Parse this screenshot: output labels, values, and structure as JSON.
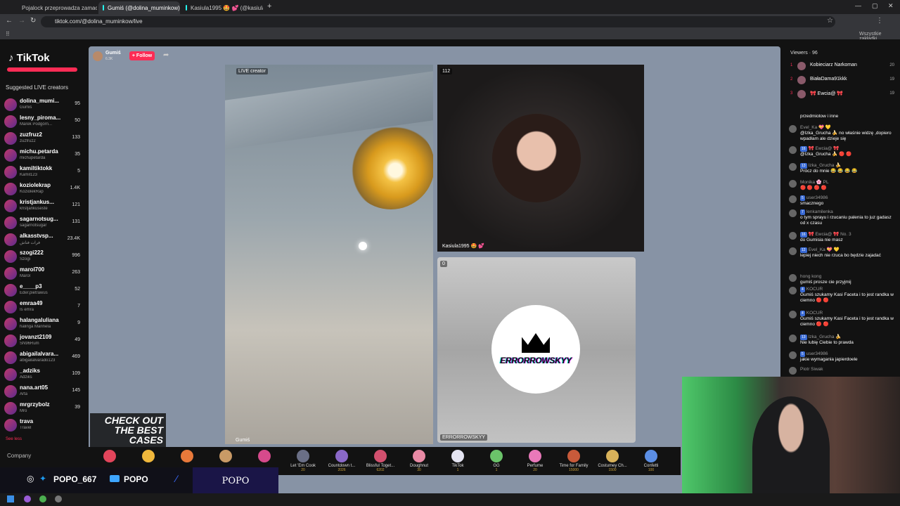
{
  "browser": {
    "tabs": [
      {
        "title": "Pojalock przeprowadza zamach"
      },
      {
        "title": "Gumiś (@dolina_muminkow)"
      },
      {
        "title": "Kasiula1995 🤩 💕 (@kasiula"
      }
    ],
    "url": "tiktok.com/@dolina_muminkow/live",
    "bookmarks_label": "Wszystkie zakładki"
  },
  "sidebar": {
    "logo": "TikTok",
    "suggested_title": "Suggested LIVE creators",
    "creators": [
      {
        "name": "dolina_mumi...",
        "sub": "Gumiś",
        "count": "95"
      },
      {
        "name": "lesny_piroma...",
        "sub": "Marek Podgórn...",
        "count": "50"
      },
      {
        "name": "zuzfruz2",
        "sub": "zuzfruz2",
        "count": "133"
      },
      {
        "name": "michu.petarda",
        "sub": "michupetarda",
        "count": "35"
      },
      {
        "name": "kamiltiktokk",
        "sub": "Kamil123",
        "count": "5"
      },
      {
        "name": "koziolekrap",
        "sub": "KoziolekRap",
        "count": "1.4K"
      },
      {
        "name": "kristjankus...",
        "sub": "kristjankuseste",
        "count": "121"
      },
      {
        "name": "sagarnotsug...",
        "sub": "sagarnotsugar",
        "count": "131"
      },
      {
        "name": "alkasstvsp...",
        "sub": "فرات فناش",
        "count": "23.4K"
      },
      {
        "name": "szogi222",
        "sub": "Szogi",
        "count": "996"
      },
      {
        "name": "marol700",
        "sub": "Marol",
        "count": "263"
      },
      {
        "name": "e____p3",
        "sub": "Eder.pietrawus",
        "count": "52"
      },
      {
        "name": "emraa49",
        "sub": "Is emra",
        "count": "7"
      },
      {
        "name": "halangaluliana",
        "sub": "halinga Marinela",
        "count": "9"
      },
      {
        "name": "jovanzt2109",
        "sub": "SN96Rum",
        "count": "49"
      },
      {
        "name": "abigailalvara...",
        "sub": "abigailalvarado123",
        "count": "469"
      },
      {
        "name": "_adziks",
        "sub": "Adziks",
        "count": "109"
      },
      {
        "name": "nana.art05",
        "sub": "Arta",
        "count": "145"
      },
      {
        "name": "mrgrzybolz",
        "sub": "Mro",
        "count": "39"
      },
      {
        "name": "trava",
        "sub": "Travel",
        "count": ""
      }
    ],
    "see_less": "See less",
    "company": "Company"
  },
  "stream": {
    "host_name": "Gumiś",
    "host_followers": "6.3K",
    "follow_label": "+ Follow",
    "live_label": "LIVE creator",
    "cam_label": "Gumiś",
    "guest1_count": "112",
    "guest1_name": "Kasiula1995 🤩 💕",
    "guest2_count": "0",
    "guest2_name": "ERRORROWSKYY",
    "guest2_logo": "ERRORROWSKYY"
  },
  "gifts": [
    {
      "name": "",
      "price": "",
      "color": "#e2455b"
    },
    {
      "name": "",
      "price": "",
      "color": "#f0b83c"
    },
    {
      "name": "",
      "price": "",
      "color": "#e8793a"
    },
    {
      "name": "",
      "price": "",
      "color": "#c99a66"
    },
    {
      "name": "",
      "price": "",
      "color": "#d64a8c"
    },
    {
      "name": "Let 'Em Cook",
      "price": "20",
      "color": "#6a6f86"
    },
    {
      "name": "Countdown t...",
      "price": "2026",
      "color": "#8a68c8"
    },
    {
      "name": "Blissful Toget...",
      "price": "6202",
      "color": "#d2506e"
    },
    {
      "name": "Doughnut",
      "price": "30",
      "color": "#e98aa5"
    },
    {
      "name": "TikTok",
      "price": "1",
      "color": "#e3e3f0"
    },
    {
      "name": "GG",
      "price": "1",
      "color": "#6bc36a"
    },
    {
      "name": "Perfume",
      "price": "20",
      "color": "#e979b9"
    },
    {
      "name": "Time for Family",
      "price": "15000",
      "color": "#c85a3a"
    },
    {
      "name": "Costumey Ch...",
      "price": "1500",
      "color": "#d9b25a"
    },
    {
      "name": "Confetti",
      "price": "100",
      "color": "#5b8ee5"
    }
  ],
  "viewers": {
    "title": "Viewers · 96",
    "list": [
      {
        "rank": "1",
        "name": "Kobieciarz Narkoman",
        "count": "20"
      },
      {
        "rank": "2",
        "name": "BiałaDama91kkk",
        "count": "19"
      },
      {
        "rank": "3",
        "name": "🎀 Ewcia@ 🎀",
        "count": "19"
      }
    ]
  },
  "chat": [
    {
      "user": "",
      "badge": "",
      "msg": "przedmiotow i inne"
    },
    {
      "user": "Evel_Ka 💝 💛",
      "badge": "",
      "msg": "@Izka_Grucha 🍌 no właśnie widzę ,dopiero wpadłam ale dzieje się"
    },
    {
      "user": "🎀 Ewcia@ 🎀",
      "badge": "16",
      "msg": "@Izka_Grucha 🍌 🔴 🔴"
    },
    {
      "user": "Izka_Grucha 🍌",
      "badge": "13",
      "msg": "Prócz do mnie 😂 😂 😂 😂"
    },
    {
      "user": "Monika 🌸 PL",
      "badge": "",
      "msg": "🔴 🔴 🔴 🔴"
    },
    {
      "user": "user34986",
      "badge": "5",
      "msg": "smacznego"
    },
    {
      "user": "lenkamilenka",
      "badge": "7",
      "msg": "o tym sprayu i rzucaniu palenia to juz gadasz od x czasu"
    },
    {
      "user": "🎀 Ewcia@ 🎀 No. 3",
      "badge": "16",
      "msg": "do Gumisia nie masz"
    },
    {
      "user": "Evel_Ka 💝 💛",
      "badge": "12",
      "msg": "lepiej niech nie rzuca bo będzie zajadać"
    },
    {
      "user": "hong kong",
      "badge": "",
      "msg": "gumiś prosze cie przyjmij"
    },
    {
      "user": "KOCUR",
      "badge": "4",
      "msg": "Gumiś szukamy Kasi Faceta i to jest randka w ciemno 🔴 🔴"
    },
    {
      "user": "KOCUR",
      "badge": "4",
      "msg": "Gumiś szukamy Kasi Faceta i to jest randka w ciemno 🔴 🔴"
    },
    {
      "user": "Izka_Grucha 🍌",
      "badge": "13",
      "msg": "Nie lubię Ciebie to prawda"
    },
    {
      "user": "user34986",
      "badge": "5",
      "msg": "jakie wymagania japierdoele"
    },
    {
      "user": "Piotr Siwak",
      "badge": "",
      "msg": ""
    }
  ],
  "overlay": {
    "ad_text": "CHECK OUT THE BEST CASES",
    "handle1": "POPO_667",
    "handle2": "POPO",
    "brand": "POPO"
  }
}
